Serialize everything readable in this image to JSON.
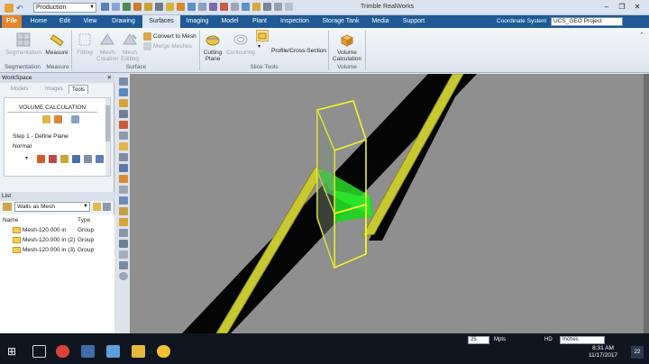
{
  "app": {
    "title": "Trimble RealWorks"
  },
  "quick_access": {
    "project_combo": "Production"
  },
  "menu": {
    "file": "File",
    "items": [
      "Home",
      "Edit",
      "View",
      "Drawing",
      "Surfaces",
      "Imaging",
      "Model",
      "Plant",
      "Inspection",
      "Storage Tank",
      "Media",
      "Support"
    ],
    "active": "Surfaces",
    "coordinate_system_label": "Coordinate System",
    "coordinate_system_value": "UCS_GEO Project"
  },
  "ribbon": {
    "segmentation_btn": "Segmentation",
    "measure_btn": "Measure",
    "fitting_btn": "Fitting",
    "mesh_creation_btn": "Mesh\nCreation",
    "mesh_editing_btn": "Mesh\nEditing",
    "convert_to_mesh": "Convert to Mesh",
    "merge_meshes": "Merge Meshes",
    "cutting_plane_btn": "Cutting\nPlane",
    "contouring_btn": "Contouring",
    "profile_btn": "Profile/Cross-Section",
    "volume_calc_btn": "Volume\nCalculation",
    "groups": {
      "segmentation": "Segmentation",
      "measure": "Measure",
      "surface": "Surface",
      "slice_tools": "Slice Tools",
      "volume": "Volume"
    }
  },
  "workspace": {
    "title": "WorkSpace",
    "tabs": [
      "Models",
      "Images",
      "Tools"
    ],
    "active_tab": "Tools",
    "tool_heading": "VOLUME CALCULATION",
    "step_label": "Step 1 - Define Plane",
    "mode": "Normal"
  },
  "list": {
    "title": "List",
    "filter": "Walls as Mesh",
    "columns": {
      "name": "Name",
      "type": "Type"
    },
    "rows": [
      {
        "name": "Mesh-120.000 in",
        "type": "Group"
      },
      {
        "name": "Mesh-120.000 in (2)",
        "type": "Group"
      },
      {
        "name": "Mesh-120.000 in (3)",
        "type": "Group"
      }
    ]
  },
  "status": {
    "points_value": "25",
    "points_unit": "Mpts",
    "hd_label": "HD",
    "units_value": "Inches"
  },
  "clock": {
    "time": "8:31 AM",
    "date": "11/17/2017"
  },
  "notifications": {
    "count": "22"
  },
  "colors": {
    "menu_bg": "#1f5a96",
    "file_tab": "#e3862b",
    "viewport_bg": "#8f8f8f",
    "wall_yellow": "#c8c832",
    "box_yellow": "#f5f52a",
    "plane_green": "#22d422",
    "taskbar": "#0f1620"
  }
}
